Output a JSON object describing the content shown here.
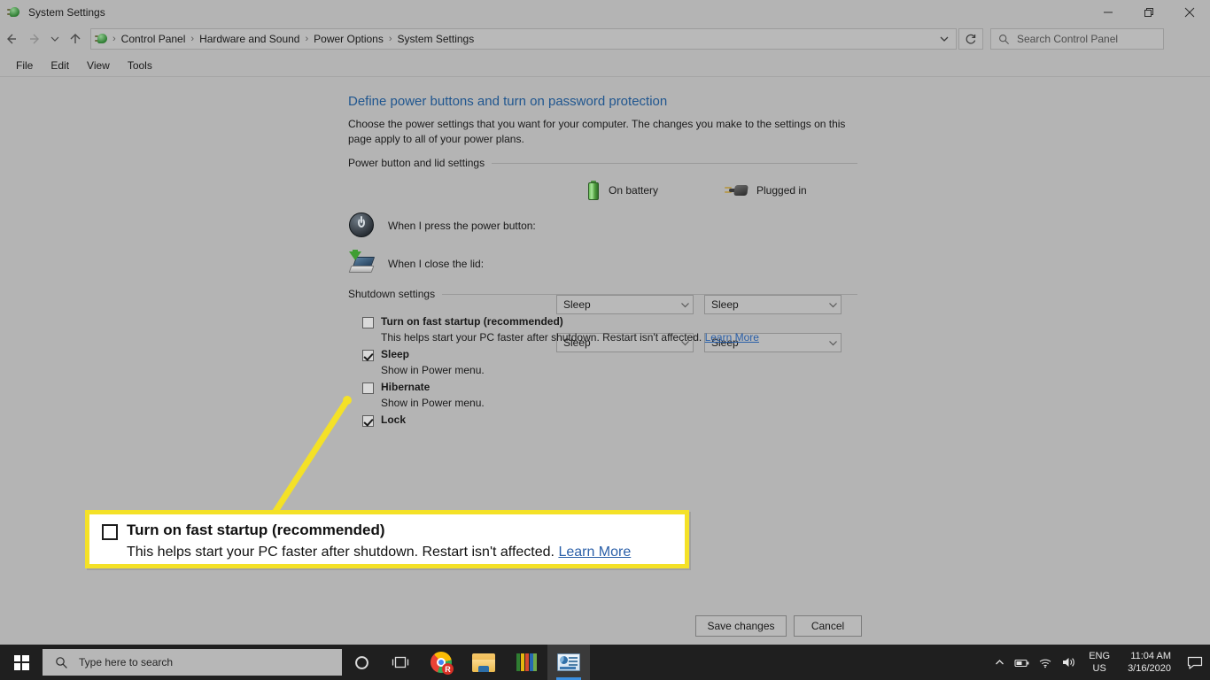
{
  "window": {
    "title": "System Settings",
    "icon": "power-plug-icon",
    "controls": {
      "minimize": "minimize-icon",
      "maximize": "restore-icon",
      "close": "close-icon"
    }
  },
  "addressbar": {
    "back": "back-arrow-icon",
    "forward": "forward-arrow-icon",
    "recent": "chevron-down-icon",
    "up": "up-arrow-icon",
    "breadcrumb": [
      "Control Panel",
      "Hardware and Sound",
      "Power Options",
      "System Settings"
    ],
    "separator": "›",
    "dropdown": "chevron-down-icon",
    "refresh": "refresh-icon",
    "search": {
      "placeholder": "Search Control Panel",
      "icon": "search-icon",
      "value": ""
    }
  },
  "menubar": {
    "items": [
      "File",
      "Edit",
      "View",
      "Tools"
    ]
  },
  "page": {
    "title": "Define power buttons and turn on password protection",
    "description": "Choose the power settings that you want for your computer. The changes you make to the settings on this page apply to all of your power plans."
  },
  "power_section": {
    "header": "Power button and lid settings",
    "columns": [
      {
        "label": "On battery",
        "icon": "battery-icon"
      },
      {
        "label": "Plugged in",
        "icon": "power-plug-icon"
      }
    ],
    "rows": [
      {
        "icon": "power-button-icon",
        "label": "When I press the power button:",
        "on_battery": "Sleep",
        "plugged_in": "Sleep"
      },
      {
        "icon": "laptop-lid-icon",
        "label": "When I close the lid:",
        "on_battery": "Sleep",
        "plugged_in": "Sleep"
      }
    ]
  },
  "shutdown_section": {
    "header": "Shutdown settings",
    "items": [
      {
        "label": "Turn on fast startup (recommended)",
        "checked": false,
        "sub": "This helps start your PC faster after shutdown. Restart isn't affected.",
        "link": "Learn More"
      },
      {
        "label": "Sleep",
        "checked": true,
        "sub": "Show in Power menu.",
        "link": ""
      },
      {
        "label": "Hibernate",
        "checked": false,
        "sub": "Show in Power menu.",
        "link": ""
      },
      {
        "label": "Lock",
        "checked": true,
        "sub": "",
        "link": ""
      }
    ]
  },
  "buttons": {
    "save": "Save changes",
    "cancel": "Cancel"
  },
  "callout": {
    "title": "Turn on fast startup (recommended)",
    "sub": "This helps start your PC faster after shutdown. Restart isn't affected.",
    "link": "Learn More",
    "border_color": "#f4e127",
    "background": "#ffffff"
  },
  "taskbar": {
    "start": "windows-logo-icon",
    "search": {
      "placeholder": "Type here to search",
      "icon": "search-icon",
      "value": ""
    },
    "cortana": "cortana-circle-icon",
    "taskview": "task-view-icon",
    "apps": [
      {
        "name": "google-chrome-icon",
        "active": false
      },
      {
        "name": "file-explorer-icon",
        "active": false
      },
      {
        "name": "paint-icon",
        "active": false
      },
      {
        "name": "control-panel-icon",
        "active": true
      }
    ],
    "tray": {
      "overflow": "chevron-up-icon",
      "battery": "battery-tray-icon",
      "network": "wifi-icon",
      "volume": "speaker-icon",
      "language_top": "ENG",
      "language_bottom": "US",
      "time": "11:04 AM",
      "date": "3/16/2020",
      "notifications": "action-center-icon"
    }
  },
  "colors": {
    "window_bg": "#b4b4b4",
    "title_link": "#20568f",
    "link": "#2a5fa8",
    "highlight_yellow": "#f4e127",
    "taskbar": "#1f1f1f"
  }
}
